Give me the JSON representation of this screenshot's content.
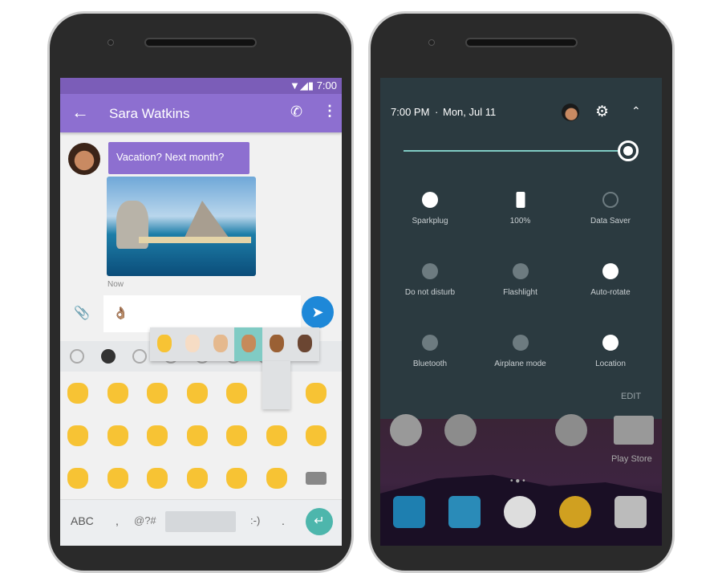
{
  "messaging": {
    "status_time": "7:00",
    "contact_name": "Sara Watkins",
    "message_text": "Vacation? Next month?",
    "timestamp": "Now",
    "input_value": "👌🏽",
    "skin_tones": [
      "#f7c334",
      "#f6dcc4",
      "#e5b98e",
      "#c68a5a",
      "#9a6034",
      "#6b4632"
    ],
    "selected_tone_index": 3,
    "emoji_tabs": [
      "recent-icon",
      "smiley-icon",
      "activity-icon",
      "food-icon",
      "travel-icon",
      "objects-icon",
      "flag-icon"
    ],
    "emoji_rows": [
      [
        "vulcan-salute",
        "sign-of-horns",
        "call-me-hand",
        "raised-hand-fingers-splayed",
        "raised-back-of-hand",
        "ok-hand",
        "thumbs-up"
      ],
      [
        "thumbs-down",
        "raised-fist",
        "oncoming-fist",
        "left-facing-fist",
        "right-facing-fist",
        "raised-hand",
        "waving-hand"
      ],
      [
        "clapping-hands",
        "open-hands",
        "writing-hand",
        "handshake",
        "nail-polish",
        "ear",
        "backspace"
      ]
    ],
    "keys": {
      "abc": "ABC",
      "comma": ",",
      "symbols": "@?#",
      "emoticon": ":-)",
      "period": "."
    },
    "colors": {
      "accent": "#8d6fd0",
      "send": "#1e88d8",
      "enter": "#4db6ac"
    }
  },
  "quick_settings": {
    "time": "7:00 PM",
    "date": "Mon, Jul 11",
    "brightness_percent": 100,
    "tiles": [
      {
        "label": "Sparkplug",
        "icon": "wifi-icon",
        "on": true
      },
      {
        "label": "100%",
        "icon": "battery-icon",
        "on": true
      },
      {
        "label": "Data Saver",
        "icon": "data-saver-icon",
        "on": false
      },
      {
        "label": "Do not disturb",
        "icon": "dnd-off-icon",
        "on": false
      },
      {
        "label": "Flashlight",
        "icon": "flashlight-off-icon",
        "on": false
      },
      {
        "label": "Auto-rotate",
        "icon": "auto-rotate-icon",
        "on": true
      },
      {
        "label": "Bluetooth",
        "icon": "bluetooth-off-icon",
        "on": false
      },
      {
        "label": "Airplane mode",
        "icon": "airplane-icon",
        "on": false
      },
      {
        "label": "Location",
        "icon": "location-icon",
        "on": true
      }
    ],
    "edit_label": "EDIT",
    "home_label": "Play Store",
    "dock": [
      "phone-icon",
      "messages-icon",
      "app-drawer-icon",
      "chrome-icon",
      "camera-icon"
    ]
  }
}
